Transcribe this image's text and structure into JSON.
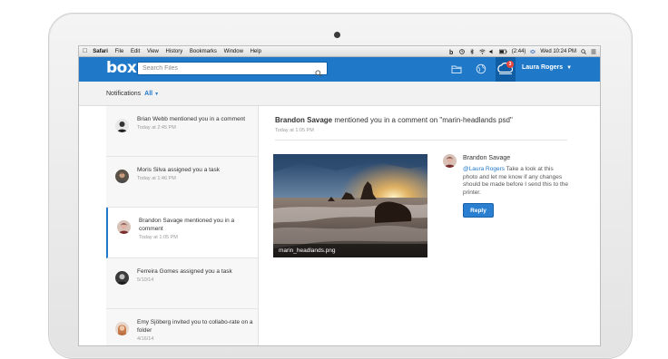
{
  "menubar": {
    "app": "Safari",
    "items": [
      "File",
      "Edit",
      "View",
      "History",
      "Bookmarks",
      "Window",
      "Help"
    ],
    "battery": "(2:44)",
    "clock": "Wed 10:24 PM"
  },
  "topnav": {
    "logo": "box",
    "search_placeholder": "Search Files",
    "badge_count": "3",
    "user_name": "Laura Rogers"
  },
  "notifbar": {
    "label": "Notifications",
    "filter": "All"
  },
  "notifications": [
    {
      "text": "Brian Webb mentioned you in a comment",
      "time": "Today at 2:45 PM",
      "avatar": "bw-avatar"
    },
    {
      "text": "Moris Silva assigned you a task",
      "time": "Today at 1:46 PM",
      "avatar": "ms-avatar"
    },
    {
      "text": "Brandon Savage mentioned you in a comment",
      "time": "Today at 1:05 PM",
      "avatar": "bs-avatar"
    },
    {
      "text": "Ferreira Gomes assigned you a task",
      "time": "5/10/14",
      "avatar": "fg-avatar"
    },
    {
      "text": "Emy Sjöberg invited you to collabo-rate on a folder",
      "time": "4/16/14",
      "avatar": "es-avatar"
    }
  ],
  "detail": {
    "author": "Brandon Savage",
    "action": " mentioned you in a comment on \"marin-headlands psd\"",
    "time": "Today at 1:05 PM",
    "image_caption": "marin_headlands.png",
    "comment_author": "Brandon Savage",
    "mention": "@Laura Rogers",
    "comment_text": " Take a look at this photo and let me know if any changes should be made before I send this to the printer.",
    "reply_label": "Reply"
  },
  "colors": {
    "brand": "#1f78c8",
    "badge": "#e8453c"
  }
}
